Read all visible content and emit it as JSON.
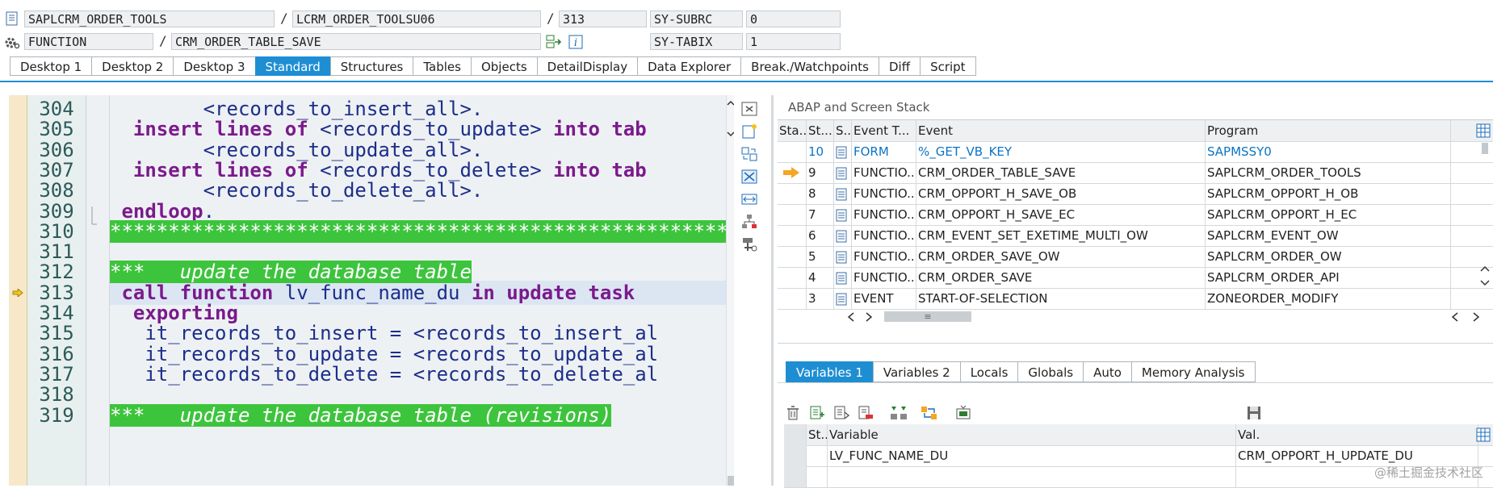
{
  "header": {
    "program": "SAPLCRM_ORDER_TOOLS",
    "include": "LCRM_ORDER_TOOLSU06",
    "line": "313",
    "sy_subrc_label": "SY-SUBRC",
    "sy_subrc_value": "0",
    "event_type": "FUNCTION",
    "event_name": "CRM_ORDER_TABLE_SAVE",
    "sy_tabix_label": "SY-TABIX",
    "sy_tabix_value": "1",
    "separator": "/"
  },
  "tabs": [
    "Desktop 1",
    "Desktop 2",
    "Desktop 3",
    "Standard",
    "Structures",
    "Tables",
    "Objects",
    "DetailDisplay",
    "Data Explorer",
    "Break./Watchpoints",
    "Diff",
    "Script"
  ],
  "active_tab": "Standard",
  "code": {
    "lines": [
      {
        "num": "304",
        "segments": [
          {
            "t": "        ",
            "c": ""
          },
          {
            "t": "<records_to_insert_all>.",
            "c": "id"
          }
        ]
      },
      {
        "num": "305",
        "segments": [
          {
            "t": "  ",
            "c": ""
          },
          {
            "t": "insert lines of",
            "c": "kw"
          },
          {
            "t": " ",
            "c": ""
          },
          {
            "t": "<records_to_update>",
            "c": "id"
          },
          {
            "t": " ",
            "c": ""
          },
          {
            "t": "into tab",
            "c": "kw"
          }
        ]
      },
      {
        "num": "306",
        "segments": [
          {
            "t": "        ",
            "c": ""
          },
          {
            "t": "<records_to_update_all>.",
            "c": "id"
          }
        ]
      },
      {
        "num": "307",
        "segments": [
          {
            "t": "  ",
            "c": ""
          },
          {
            "t": "insert lines of",
            "c": "kw"
          },
          {
            "t": " ",
            "c": ""
          },
          {
            "t": "<records_to_delete>",
            "c": "id"
          },
          {
            "t": " ",
            "c": ""
          },
          {
            "t": "into tab",
            "c": "kw"
          }
        ]
      },
      {
        "num": "308",
        "segments": [
          {
            "t": "        ",
            "c": ""
          },
          {
            "t": "<records_to_delete_all>.",
            "c": "id"
          }
        ]
      },
      {
        "num": "309",
        "segments": [
          {
            "t": " ",
            "c": ""
          },
          {
            "t": "endloop",
            "c": "kw"
          },
          {
            "t": ".",
            "c": "id"
          }
        ]
      },
      {
        "num": "310",
        "segments": [
          {
            "t": "*****************************************************",
            "c": "starbar"
          }
        ]
      },
      {
        "num": "311",
        "segments": []
      },
      {
        "num": "312",
        "segments": [
          {
            "t": "***   update the database table",
            "c": "comment"
          }
        ]
      },
      {
        "num": "313",
        "segments": [
          {
            "t": " ",
            "c": ""
          },
          {
            "t": "call function",
            "c": "kw"
          },
          {
            "t": " ",
            "c": ""
          },
          {
            "t": "lv_func_name_du",
            "c": "id"
          },
          {
            "t": " ",
            "c": ""
          },
          {
            "t": "in update task",
            "c": "kw"
          }
        ]
      },
      {
        "num": "314",
        "segments": [
          {
            "t": "  ",
            "c": ""
          },
          {
            "t": "exporting",
            "c": "kw"
          }
        ]
      },
      {
        "num": "315",
        "segments": [
          {
            "t": "   ",
            "c": ""
          },
          {
            "t": "it_records_to_insert = <records_to_insert_al",
            "c": "id"
          }
        ]
      },
      {
        "num": "316",
        "segments": [
          {
            "t": "   ",
            "c": ""
          },
          {
            "t": "it_records_to_update = <records_to_update_al",
            "c": "id"
          }
        ]
      },
      {
        "num": "317",
        "segments": [
          {
            "t": "   ",
            "c": ""
          },
          {
            "t": "it_records_to_delete = <records_to_delete_al",
            "c": "id"
          }
        ]
      },
      {
        "num": "318",
        "segments": []
      },
      {
        "num": "319",
        "segments": [
          {
            "t": "***   update the database table (revisions)",
            "c": "comment"
          }
        ]
      }
    ]
  },
  "stack": {
    "title": "ABAP and Screen Stack",
    "columns": [
      "Sta...",
      "St...",
      "S...",
      "Event T...",
      "Event",
      "Program"
    ],
    "rows": [
      {
        "level": "10",
        "type": "FORM",
        "event": "%_GET_VB_KEY",
        "program": "SAPMSSY0",
        "highlight": true
      },
      {
        "level": "9",
        "type": "FUNCTIO...",
        "event": "CRM_ORDER_TABLE_SAVE",
        "program": "SAPLCRM_ORDER_TOOLS",
        "current": true
      },
      {
        "level": "8",
        "type": "FUNCTIO...",
        "event": "CRM_OPPORT_H_SAVE_OB",
        "program": "SAPLCRM_OPPORT_H_OB"
      },
      {
        "level": "7",
        "type": "FUNCTIO...",
        "event": "CRM_OPPORT_H_SAVE_EC",
        "program": "SAPLCRM_OPPORT_H_EC"
      },
      {
        "level": "6",
        "type": "FUNCTIO...",
        "event": "CRM_EVENT_SET_EXETIME_MULTI_OW",
        "program": "SAPLCRM_EVENT_OW"
      },
      {
        "level": "5",
        "type": "FUNCTIO...",
        "event": "CRM_ORDER_SAVE_OW",
        "program": "SAPLCRM_ORDER_OW"
      },
      {
        "level": "4",
        "type": "FUNCTIO...",
        "event": "CRM_ORDER_SAVE",
        "program": "SAPLCRM_ORDER_API"
      },
      {
        "level": "3",
        "type": "EVENT",
        "event": "START-OF-SELECTION",
        "program": "ZONEORDER_MODIFY"
      }
    ],
    "hscroll_grip": "≡"
  },
  "variables": {
    "tabs": [
      "Variables 1",
      "Variables 2",
      "Locals",
      "Globals",
      "Auto",
      "Memory Analysis"
    ],
    "active_tab": "Variables 1",
    "columns": [
      "St...",
      "Variable",
      "Val."
    ],
    "rows": [
      {
        "variable": "LV_FUNC_NAME_DU",
        "value": "CRM_OPPORT_H_UPDATE_DU"
      }
    ]
  },
  "watermark": "@稀土掘金技术社区",
  "colors": {
    "accent": "#1e8ed3",
    "keyword": "#7a1a8c",
    "comment_bg": "#3dc43d",
    "arrow": "#f5a623"
  }
}
